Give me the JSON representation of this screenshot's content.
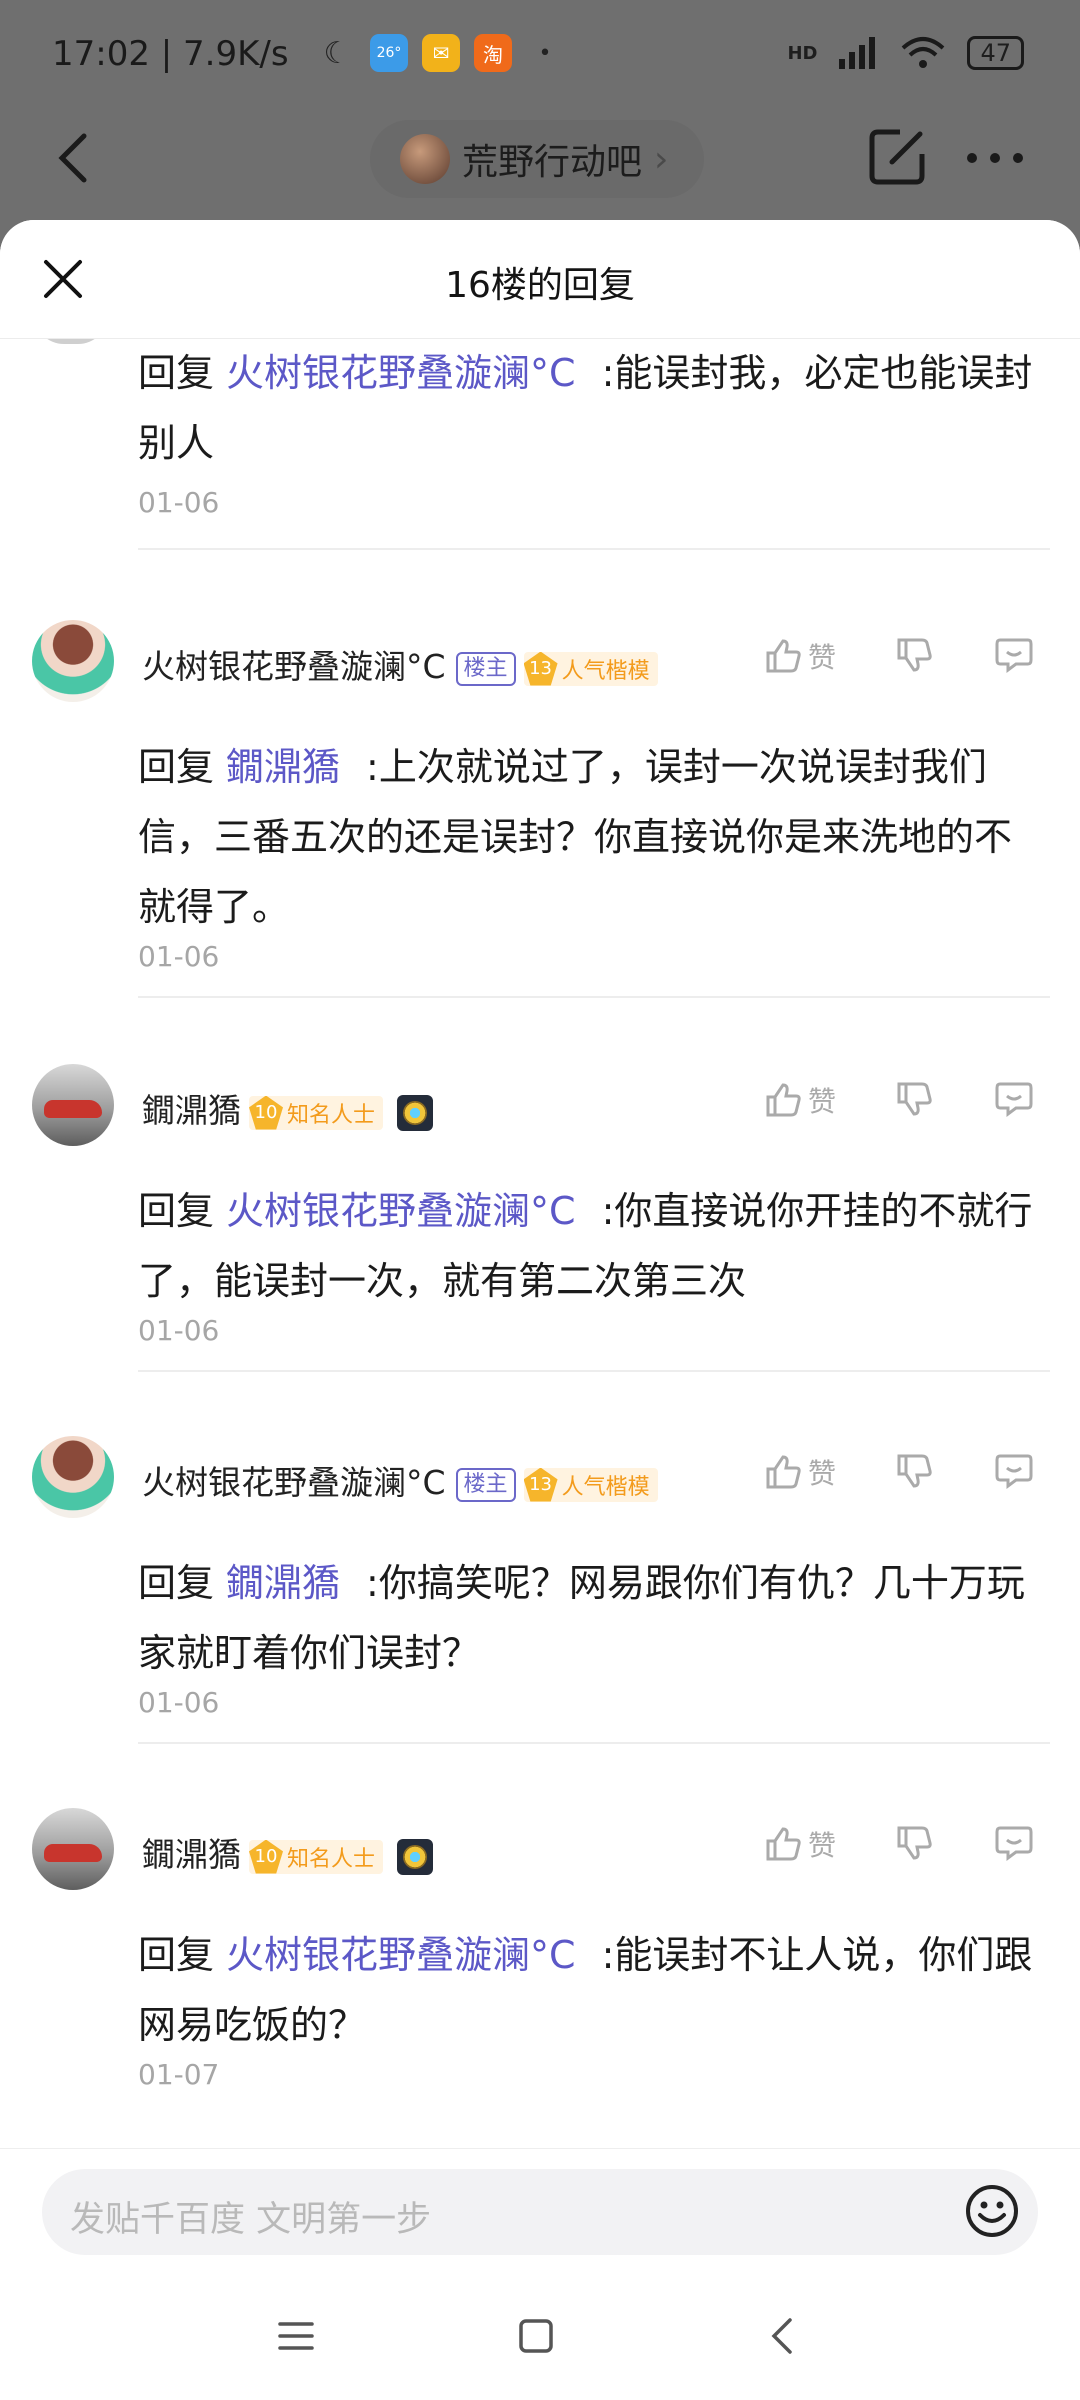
{
  "status_bar": {
    "time": "17:02 | 7.9K/s",
    "battery": "47",
    "app_icons": [
      {
        "name": "moon-icon",
        "glyph": "☾",
        "color": "#2a2a2a"
      },
      {
        "name": "weather-app-icon",
        "glyph": "26°",
        "color": "#3c9be8"
      },
      {
        "name": "mail-app-icon",
        "glyph": "✉",
        "color": "#f2b21a"
      },
      {
        "name": "taobao-app-icon",
        "glyph": "淘",
        "color": "#f06a1a"
      }
    ],
    "network": "HD"
  },
  "topbar": {
    "forum_name": "荒野行动吧"
  },
  "sheet": {
    "title": "16楼的回复"
  },
  "reply_prefix": "回复",
  "like_label": "赞",
  "badges": {
    "host": "楼主",
    "level_host": "13",
    "title_host": "人气楷模",
    "level_user": "10",
    "title_user": "知名人士"
  },
  "first_reply": {
    "mention": "火树银花野叠漩澜°C",
    "text": ":能误封我，必定也能误封别人",
    "date": "01-06"
  },
  "replies": [
    {
      "user": "火树银花野叠漩澜°C",
      "is_host": true,
      "mention": "鐗濎獢",
      "text": ":上次就说过了，误封一次说误封我们信，三番五次的还是误封？你直接说你是来洗地的不就得了。",
      "date": "01-06"
    },
    {
      "user": "鐗濎獢",
      "is_host": false,
      "mention": "火树银花野叠漩澜°C",
      "text": ":你直接说你开挂的不就行了，能误封一次，就有第二次第三次",
      "date": "01-06"
    },
    {
      "user": "火树银花野叠漩澜°C",
      "is_host": true,
      "mention": "鐗濎獢",
      "text": ":你搞笑呢？网易跟你们有仇？几十万玩家就盯着你们误封？",
      "date": "01-06"
    },
    {
      "user": "鐗濎獢",
      "is_host": false,
      "mention": "火树银花野叠漩澜°C",
      "text": ":能误封不让人说，你们跟网易吃饭的？",
      "date": "01-07"
    }
  ],
  "composer": {
    "placeholder": "发贴千百度 文明第一步"
  }
}
